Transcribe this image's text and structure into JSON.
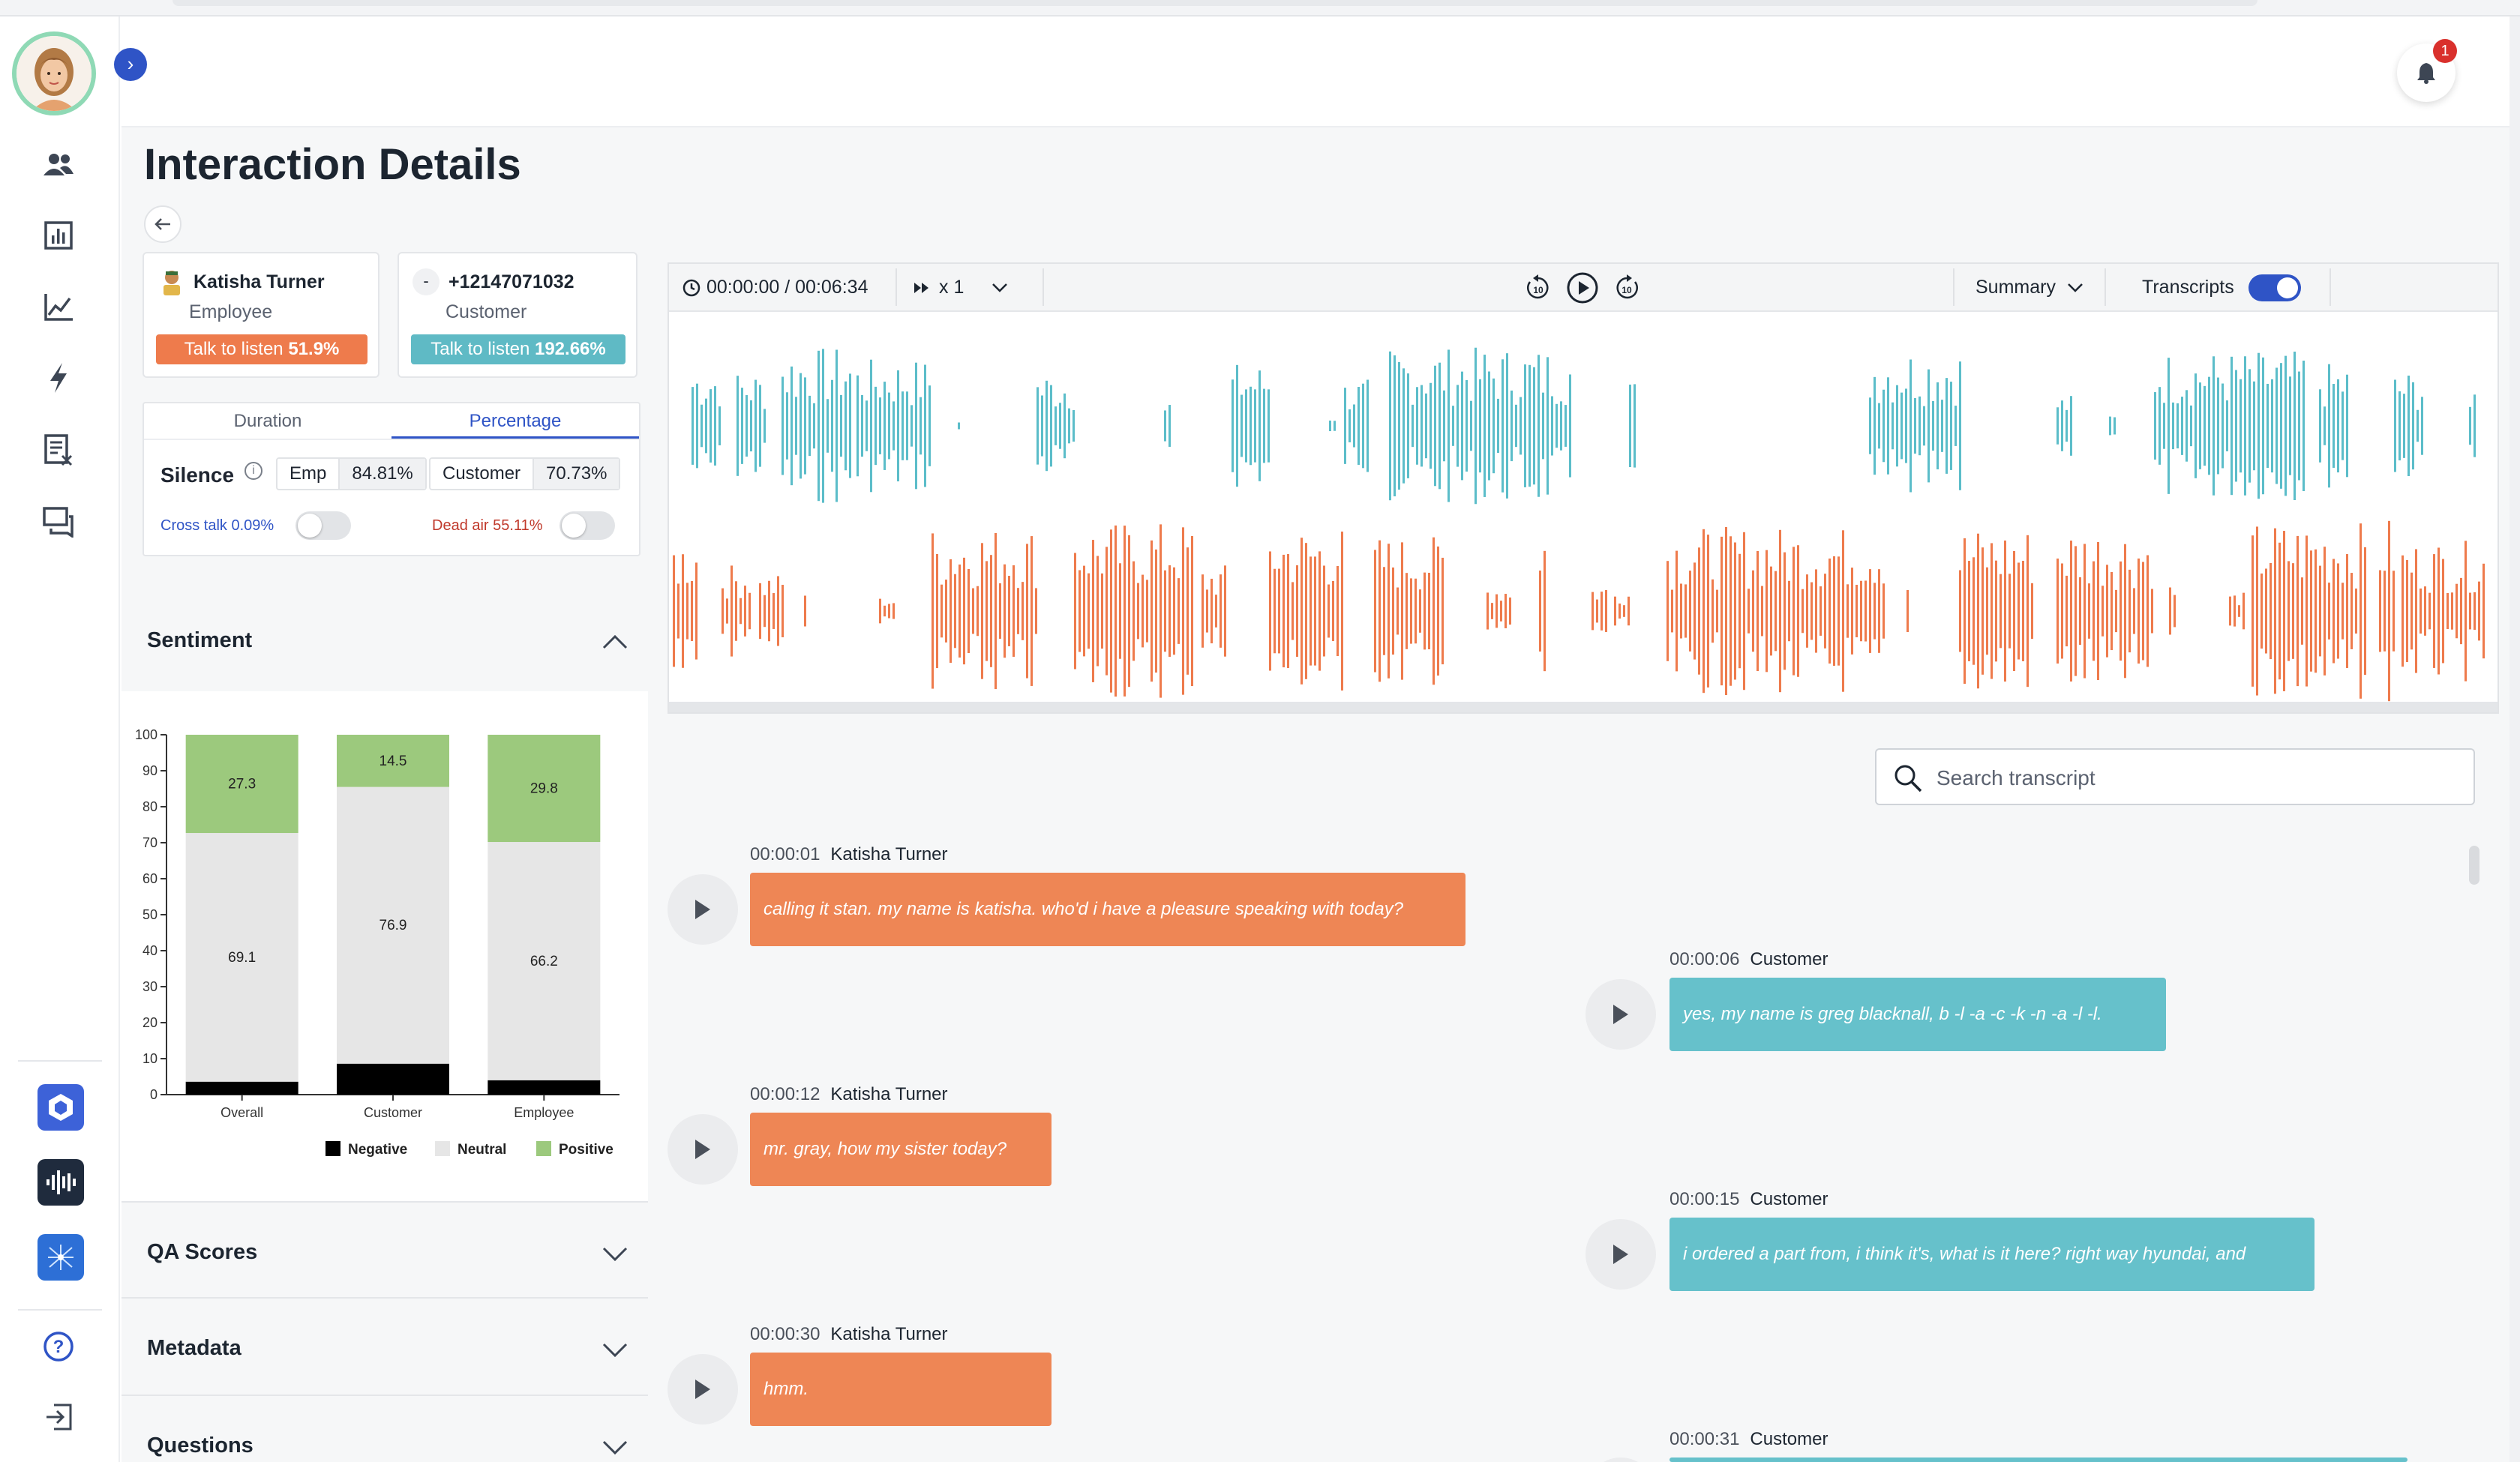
{
  "page": {
    "title": "Interaction Details"
  },
  "nav": {
    "items": [
      "team-icon",
      "report-icon",
      "trend-icon",
      "bolt-icon",
      "document-icon",
      "chat-icon"
    ],
    "apps": [
      "hexagon-app-icon",
      "waveform-app-icon",
      "network-app-icon"
    ],
    "bottom": [
      "help-icon",
      "logout-icon"
    ]
  },
  "notifications": {
    "count": "1"
  },
  "participants": {
    "employee": {
      "name": "Katisha Turner",
      "role": "Employee",
      "ttl_label": "Talk to listen ",
      "ttl_value": "51.9%",
      "color": "#ee7b4c"
    },
    "customer": {
      "badge": "-",
      "name": "+12147071032",
      "role": "Customer",
      "ttl_label": "Talk to listen ",
      "ttl_value": "192.66%",
      "color": "#5fbac5"
    }
  },
  "silence": {
    "tabs": [
      "Duration",
      "Percentage"
    ],
    "active_tab": "Percentage",
    "label": "Silence",
    "emp_label": "Emp",
    "emp_value": "84.81%",
    "customer_label": "Customer",
    "customer_value": "70.73%",
    "cross_talk": "Cross talk 0.09%",
    "dead_air": "Dead air 55.11%"
  },
  "sections": {
    "sentiment": "Sentiment",
    "qa": "QA Scores",
    "metadata": "Metadata",
    "questions": "Questions"
  },
  "chart_data": {
    "type": "bar",
    "stacked": true,
    "categories": [
      "Overall",
      "Customer",
      "Employee"
    ],
    "series": [
      {
        "name": "Negative",
        "values": [
          3.6,
          8.6,
          4.0
        ],
        "color": "#000000"
      },
      {
        "name": "Neutral",
        "values": [
          69.1,
          76.9,
          66.2
        ],
        "color": "#e6e6e6"
      },
      {
        "name": "Positive",
        "values": [
          27.3,
          14.5,
          29.8
        ],
        "color": "#9cc97d"
      }
    ],
    "ylim": [
      0,
      100
    ],
    "yticks": [
      0,
      10,
      20,
      30,
      40,
      50,
      60,
      70,
      80,
      90,
      100
    ],
    "labels_shown": [
      "Neutral",
      "Positive"
    ],
    "legend": "bottom-right"
  },
  "player": {
    "time": "00:00:00 / 00:06:34",
    "speed": "x 1",
    "summary": "Summary",
    "transcripts": "Transcripts",
    "transcripts_on": true,
    "customer_wave_color": "#5bbdc9",
    "employee_wave_color": "#ee7b4c"
  },
  "search": {
    "placeholder": "Search transcript"
  },
  "transcript": [
    {
      "time": "00:00:01",
      "speaker": "Katisha Turner",
      "side": "emp",
      "text": "calling it stan. my name is katisha. who'd i have a pleasure speaking with today?"
    },
    {
      "time": "00:00:06",
      "speaker": "Customer",
      "side": "cus",
      "text": "yes, my name is greg blacknall, b -l -a -c -k -n -a -l -l."
    },
    {
      "time": "00:00:12",
      "speaker": "Katisha Turner",
      "side": "emp",
      "text": "mr. gray, how my sister today?"
    },
    {
      "time": "00:00:15",
      "speaker": "Customer",
      "side": "cus",
      "text": "i ordered a part from, i think it's, what is it here? right way hyundai, and"
    },
    {
      "time": "00:00:30",
      "speaker": "Katisha Turner",
      "side": "emp",
      "text": "hmm."
    },
    {
      "time": "00:00:31",
      "speaker": "Customer",
      "side": "cus",
      "text": ""
    }
  ]
}
